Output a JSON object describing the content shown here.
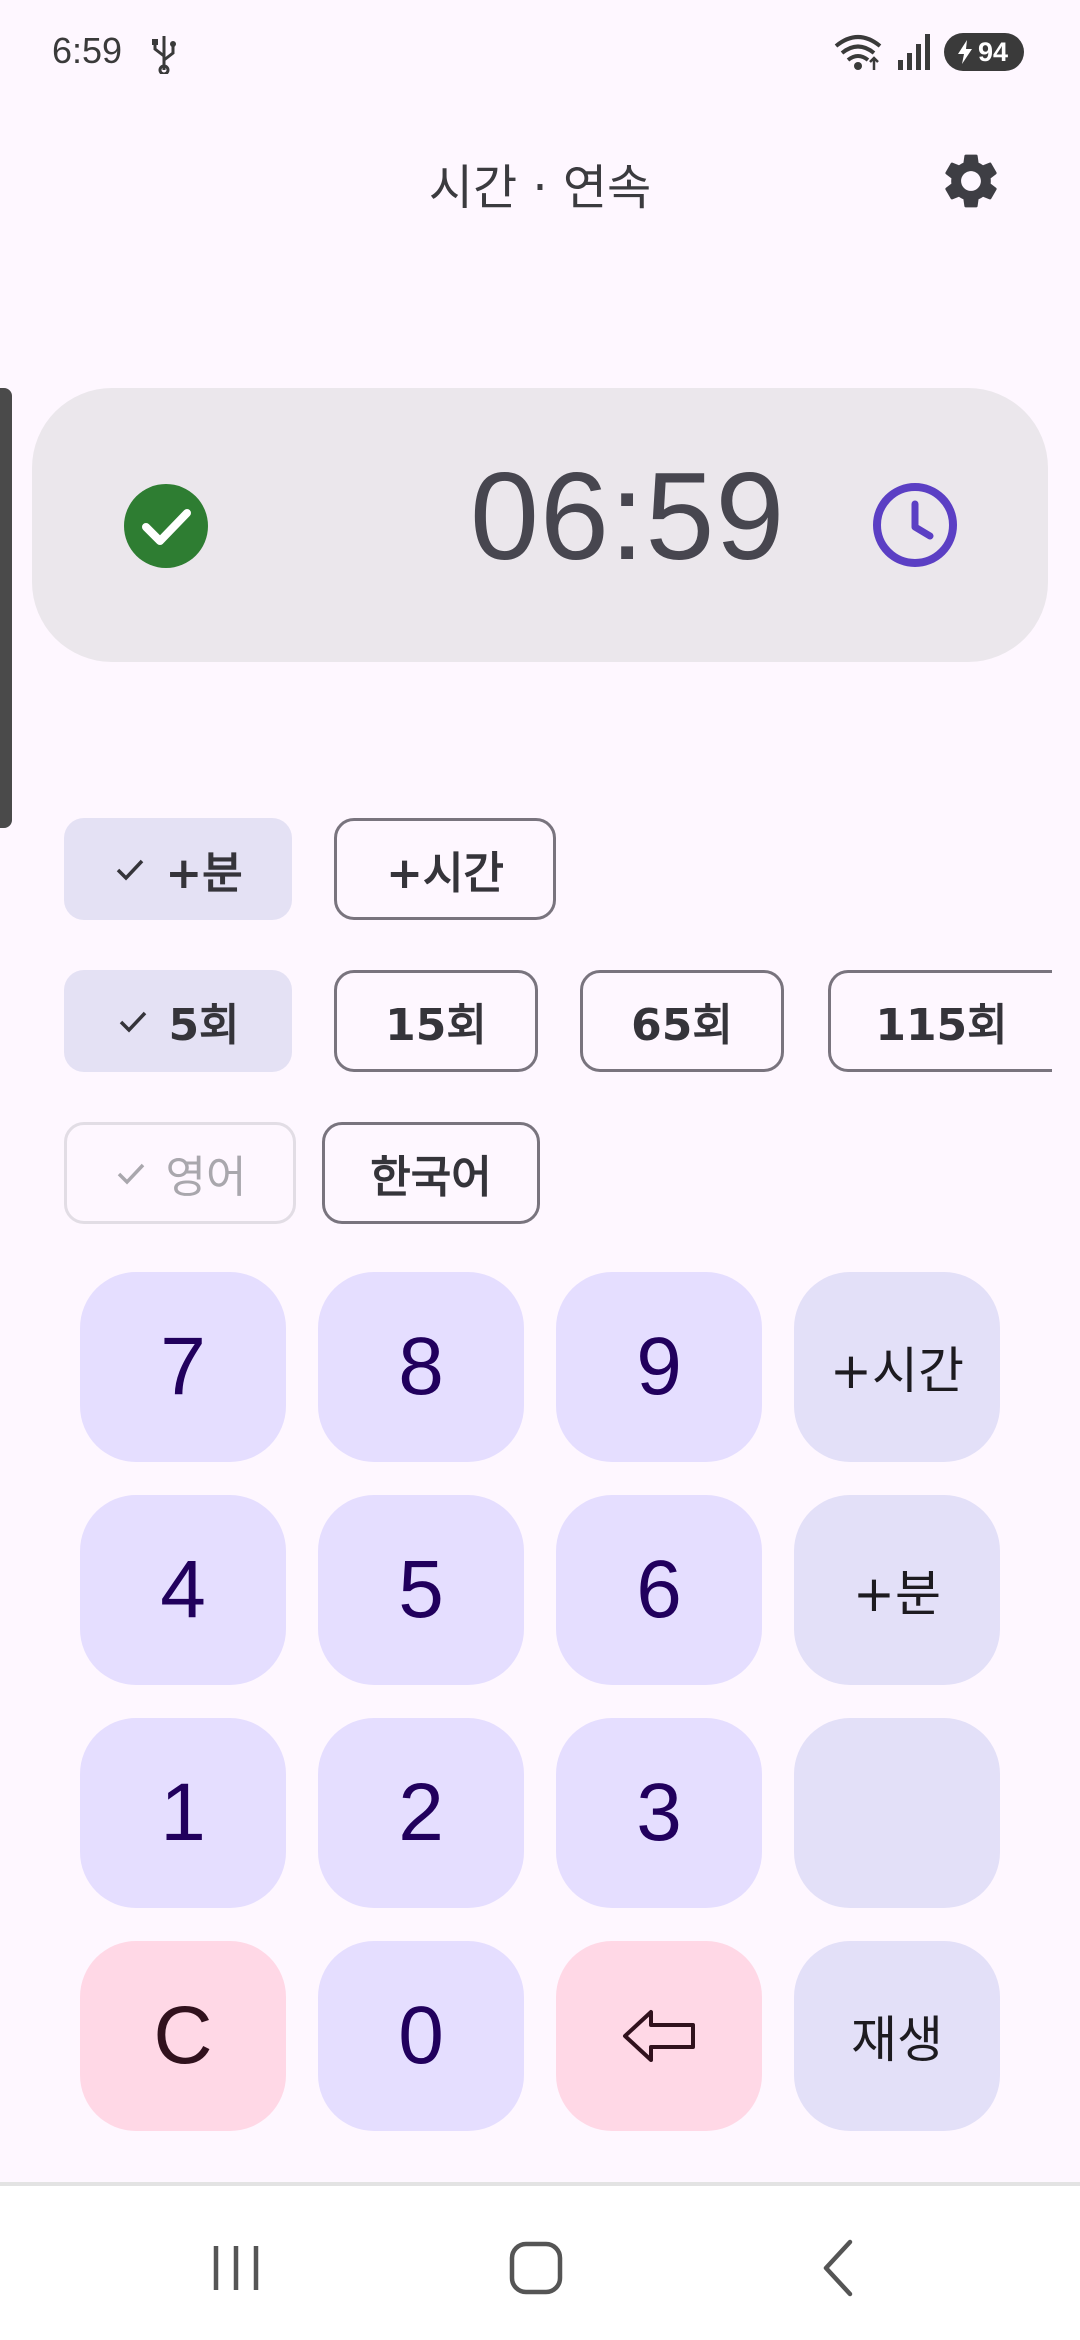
{
  "status_bar": {
    "time": "6:59",
    "battery": "94",
    "icons": [
      "usb-icon",
      "wifi-icon",
      "signal-icon",
      "battery-icon"
    ]
  },
  "header": {
    "title": "시간 · 연속",
    "settings_icon": "gear-icon"
  },
  "time_display": {
    "status_icon": "check-circle-icon",
    "value": "06:59",
    "clock_icon": "clock-icon"
  },
  "chips": {
    "unit": [
      {
        "label": "+분",
        "selected": true
      },
      {
        "label": "+시간",
        "selected": false
      }
    ],
    "repeat": [
      {
        "label": "5회",
        "selected": true
      },
      {
        "label": "15회",
        "selected": false
      },
      {
        "label": "65회",
        "selected": false
      },
      {
        "label": "115회",
        "selected": false
      }
    ],
    "language": [
      {
        "label": "영어",
        "selected": true,
        "disabled": true
      },
      {
        "label": "한국어",
        "selected": false
      }
    ]
  },
  "keypad": {
    "row1": [
      "7",
      "8",
      "9",
      "+시간"
    ],
    "row2": [
      "4",
      "5",
      "6",
      "+분"
    ],
    "row3": [
      "1",
      "2",
      "3",
      ""
    ],
    "row4": [
      "C",
      "0",
      "backspace-icon",
      "재생"
    ]
  },
  "colors": {
    "background": "#fef7ff",
    "accent_check": "#2e7d32",
    "accent_clock": "#5b3fc4",
    "key_digit": "#e5deff",
    "key_red": "#ffd8e6"
  },
  "nav_bar": [
    "recent-apps-icon",
    "home-icon",
    "back-icon"
  ]
}
